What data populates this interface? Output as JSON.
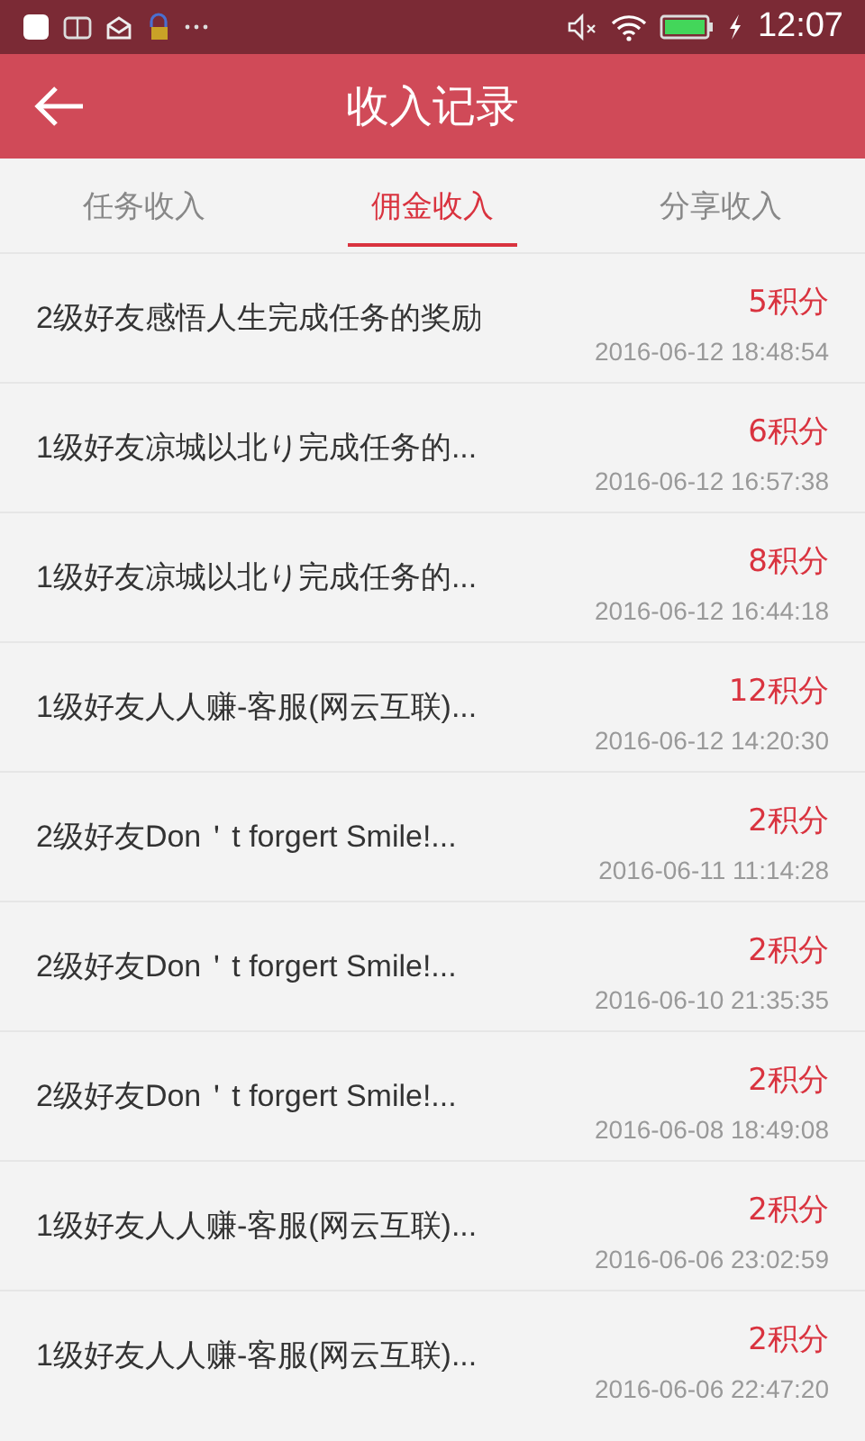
{
  "status_bar": {
    "time": "12:07"
  },
  "header": {
    "title": "收入记录"
  },
  "tabs": [
    {
      "label": "任务收入",
      "selected": false
    },
    {
      "label": "佣金收入",
      "selected": true
    },
    {
      "label": "分享收入",
      "selected": false
    }
  ],
  "records": [
    {
      "description": "2级好友感悟人生完成任务的奖励",
      "points": "5积分",
      "time": "2016-06-12 18:48:54"
    },
    {
      "description": "1级好友凉城以北り完成任务的...",
      "points": "6积分",
      "time": "2016-06-12 16:57:38"
    },
    {
      "description": "1级好友凉城以北り完成任务的...",
      "points": "8积分",
      "time": "2016-06-12 16:44:18"
    },
    {
      "description": "1级好友人人赚-客服(网云互联)...",
      "points": "12积分",
      "time": "2016-06-12 14:20:30"
    },
    {
      "description": "2级好友Don＇t  forgert  Smile!...",
      "points": "2积分",
      "time": "2016-06-11 11:14:28"
    },
    {
      "description": "2级好友Don＇t  forgert  Smile!...",
      "points": "2积分",
      "time": "2016-06-10 21:35:35"
    },
    {
      "description": "2级好友Don＇t  forgert  Smile!...",
      "points": "2积分",
      "time": "2016-06-08 18:49:08"
    },
    {
      "description": "1级好友人人赚-客服(网云互联)...",
      "points": "2积分",
      "time": "2016-06-06 23:02:59"
    },
    {
      "description": "1级好友人人赚-客服(网云互联)...",
      "points": "2积分",
      "time": "2016-06-06 22:47:20"
    }
  ]
}
